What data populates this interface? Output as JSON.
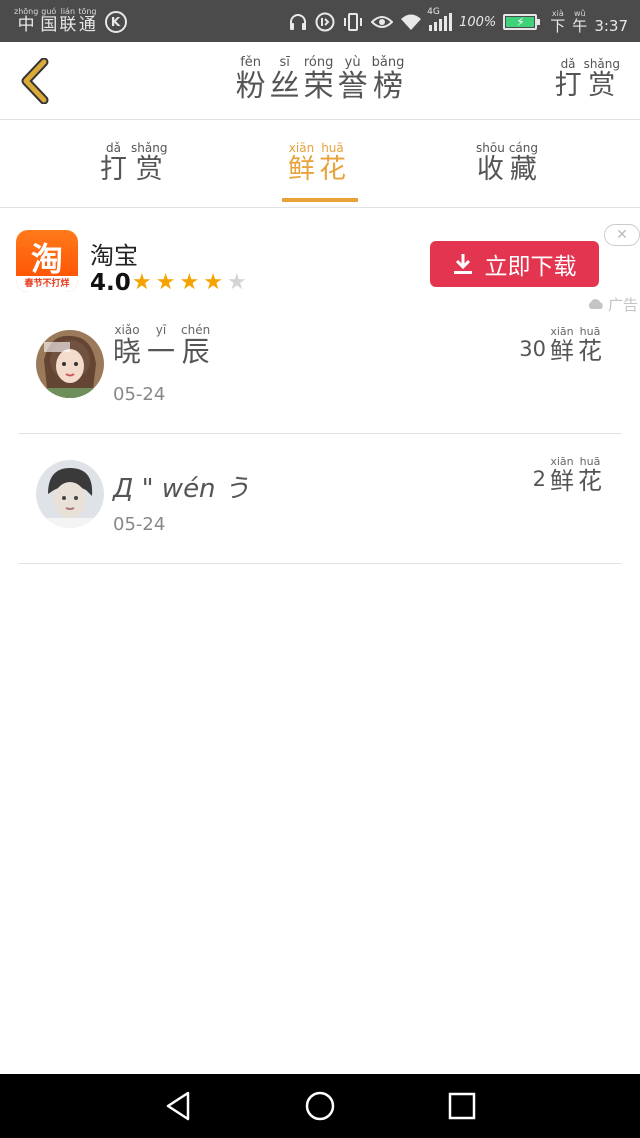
{
  "status_bar": {
    "carrier": [
      {
        "py": "zhōng",
        "hz": "中"
      },
      {
        "py": "guó",
        "hz": "国"
      },
      {
        "py": "lián",
        "hz": "联"
      },
      {
        "py": "tōng",
        "hz": "通"
      }
    ],
    "carrier_badge": "K",
    "network": "4G",
    "battery_text": "100%",
    "battery_level": 1.0,
    "time_label": [
      {
        "py": "xià",
        "hz": "下"
      },
      {
        "py": "wǔ",
        "hz": "午"
      }
    ],
    "time": "3:37"
  },
  "header": {
    "back_icon": "chevron-left-icon",
    "title": [
      {
        "py": "fěn",
        "hz": "粉"
      },
      {
        "py": "sī",
        "hz": "丝"
      },
      {
        "py": "róng",
        "hz": "荣"
      },
      {
        "py": "yù",
        "hz": "誉"
      },
      {
        "py": "bǎng",
        "hz": "榜"
      }
    ],
    "right_action": [
      {
        "py": "dǎ",
        "hz": "打"
      },
      {
        "py": "shǎng",
        "hz": "赏"
      }
    ]
  },
  "tabs": [
    {
      "chars": [
        {
          "py": "dǎ",
          "hz": "打"
        },
        {
          "py": "shǎng",
          "hz": "赏"
        }
      ],
      "active": false
    },
    {
      "chars": [
        {
          "py": "xiān",
          "hz": "鲜"
        },
        {
          "py": "huā",
          "hz": "花"
        }
      ],
      "active": true
    },
    {
      "chars": [
        {
          "py": "shōu",
          "hz": "收"
        },
        {
          "py": "cáng",
          "hz": "藏"
        }
      ],
      "active": false
    }
  ],
  "ad": {
    "app_name": "淘宝",
    "logo_char": "淘",
    "logo_band": "春节不打烊",
    "rating": "4.0",
    "stars_filled": 4,
    "stars_total": 5,
    "button_label": "立即下载",
    "close_symbol": "✕",
    "ad_label": "广告",
    "accent": "#e43550"
  },
  "list": [
    {
      "name_chars": [
        {
          "py": "xiǎo",
          "hz": "晓"
        },
        {
          "py": "yī",
          "hz": "一"
        },
        {
          "py": "chén",
          "hz": "辰"
        }
      ],
      "name_plain": "",
      "date": "05-24",
      "count": "30",
      "unit": [
        {
          "py": "xiān",
          "hz": "鲜"
        },
        {
          "py": "huā",
          "hz": "花"
        }
      ]
    },
    {
      "name_chars": [],
      "name_plain": "Д \" wén う",
      "date": "05-24",
      "count": "2",
      "unit": [
        {
          "py": "xiān",
          "hz": "鲜"
        },
        {
          "py": "huā",
          "hz": "花"
        }
      ]
    }
  ],
  "colors": {
    "status_bar": "#4b4b4b",
    "accent_tab": "#e8a23a",
    "back_icon": "#d9a93a"
  }
}
